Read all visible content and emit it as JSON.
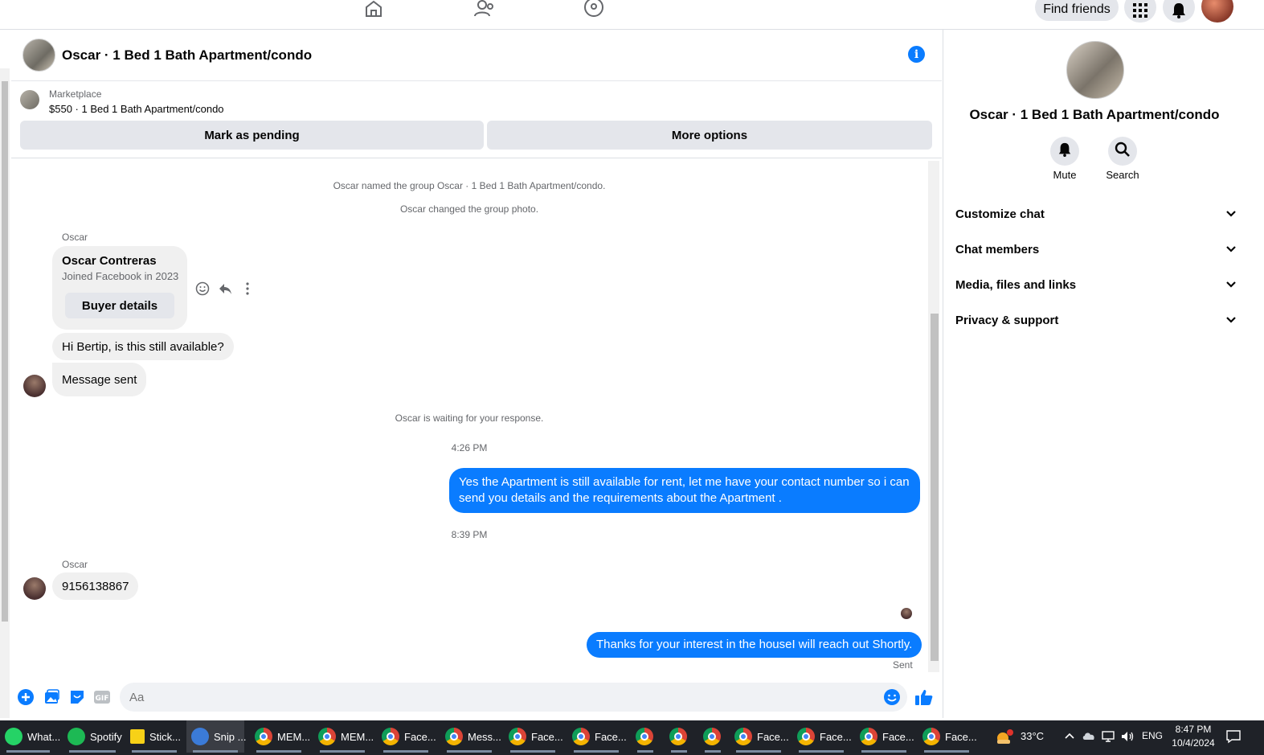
{
  "topnav": {
    "find_friends": "Find friends"
  },
  "chat": {
    "title": "Oscar · 1 Bed 1 Bath Apartment/condo",
    "marketplace": {
      "label": "Marketplace",
      "item": "$550 · 1 Bed 1 Bath Apartment/condo",
      "mark_pending": "Mark as pending",
      "more_options": "More options"
    },
    "system": {
      "named_group": "Oscar named the group Oscar · 1 Bed 1 Bath Apartment/condo.",
      "changed_photo": "Oscar changed the group photo.",
      "waiting": "Oscar is waiting for your response."
    },
    "sender_name": "Oscar",
    "buyer_card": {
      "name": "Oscar Contreras",
      "joined": "Joined Facebook in 2023",
      "button": "Buyer details"
    },
    "msg_in_1": "Hi Bertip, is this still available?",
    "msg_in_2": "Message sent",
    "time_1": "4:26 PM",
    "msg_out_1": "Yes the Apartment is still available for rent, let me have your contact number so i can send you details and the requirements about the Apartment .",
    "time_2": "8:39 PM",
    "msg_in_3": "9156138867",
    "msg_out_2": "Thanks for your interest in the houseI will reach out Shortly.",
    "status": "Sent",
    "composer_placeholder": "Aa"
  },
  "right_panel": {
    "title": "Oscar · 1 Bed 1 Bath Apartment/condo",
    "actions": [
      {
        "label": "Mute",
        "icon": "bell-icon"
      },
      {
        "label": "Search",
        "icon": "search-icon"
      }
    ],
    "sections": [
      {
        "label": "Customize chat"
      },
      {
        "label": "Chat members"
      },
      {
        "label": "Media, files and links"
      },
      {
        "label": "Privacy & support"
      }
    ]
  },
  "taskbar": {
    "items": [
      {
        "label": "What...",
        "icon": "whatsapp-icon",
        "color": "#25d366"
      },
      {
        "label": "Spotify",
        "icon": "spotify-icon",
        "color": "#1db954"
      },
      {
        "label": "Stick...",
        "icon": "sticky-notes-icon",
        "color": "#f7d117"
      },
      {
        "label": "Snip ...",
        "icon": "snip-icon",
        "color": "#3b7bd8"
      },
      {
        "label": "MEM...",
        "icon": "chrome-icon",
        "color": "#db4437"
      },
      {
        "label": "MEM...",
        "icon": "chrome-icon",
        "color": "#db4437"
      },
      {
        "label": "Face...",
        "icon": "chrome-icon",
        "color": "#db4437"
      },
      {
        "label": "Mess...",
        "icon": "chrome-icon",
        "color": "#db4437"
      },
      {
        "label": "Face...",
        "icon": "chrome-icon",
        "color": "#db4437"
      },
      {
        "label": "Face...",
        "icon": "chrome-icon",
        "color": "#db4437"
      },
      {
        "label": "",
        "icon": "chrome-icon",
        "color": "#db4437"
      },
      {
        "label": "",
        "icon": "chrome-icon",
        "color": "#db4437"
      },
      {
        "label": "",
        "icon": "chrome-icon",
        "color": "#db4437"
      },
      {
        "label": "Face...",
        "icon": "chrome-icon",
        "color": "#db4437"
      },
      {
        "label": "Face...",
        "icon": "chrome-icon",
        "color": "#db4437"
      },
      {
        "label": "Face...",
        "icon": "chrome-icon",
        "color": "#db4437"
      },
      {
        "label": "Face...",
        "icon": "chrome-icon",
        "color": "#db4437"
      }
    ],
    "temperature": "33°C",
    "language": "ENG",
    "time": "8:47 PM",
    "date": "10/4/2024"
  },
  "colors": {
    "accent": "#0a7cff",
    "bubble_in": "#f0f0f0",
    "taskbar": "#1f2228"
  }
}
